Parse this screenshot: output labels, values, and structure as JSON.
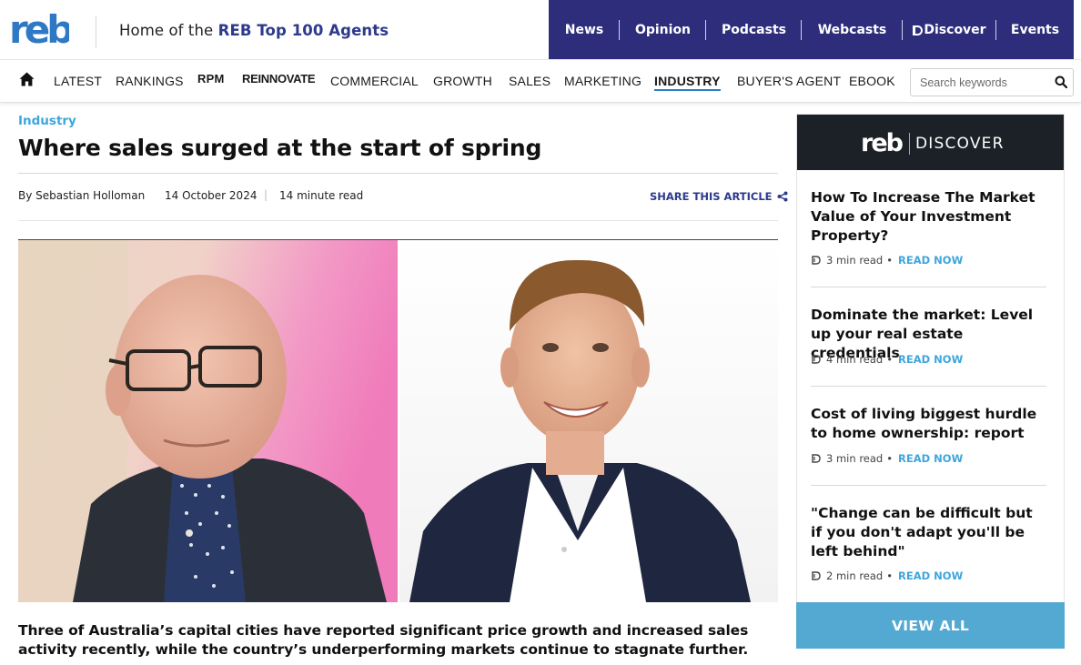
{
  "header": {
    "logo_text": "reb",
    "tagline_prefix": "Home of the ",
    "tagline_highlight": "REB Top 100 Agents",
    "top_nav": [
      "News",
      "Opinion",
      "Podcasts",
      "Webcasts",
      "Discover",
      "Events"
    ]
  },
  "subnav": {
    "items": [
      "LATEST",
      "RANKINGS",
      "RPM",
      "REINNOVATE",
      "COMMERCIAL",
      "GROWTH",
      "SALES",
      "MARKETING",
      "INDUSTRY",
      "BUYER'S AGENT",
      "EBOOK"
    ],
    "active": "INDUSTRY",
    "search_placeholder": "Search keywords"
  },
  "article": {
    "category": "Industry",
    "title": "Where sales surged at the start of spring",
    "byline": "By Sebastian Holloman",
    "date": "14 October 2024",
    "separator": "|",
    "read_time": "14 minute read",
    "share_label": "SHARE THIS ARTICLE",
    "lede": "Three of Australia’s capital cities have reported significant price growth and increased sales activity recently, while the country’s underperforming markets continue to stagnate further."
  },
  "sidebar": {
    "brand_reb": "reb",
    "brand_discover": "DISCOVER",
    "items": [
      {
        "title": "How To Increase The Market Value of Your Investment Property?",
        "read_time": "3 min read",
        "cta": "READ NOW"
      },
      {
        "title": "Dominate the market: Level up your real estate credentials",
        "read_time": "4 min read",
        "cta": "READ NOW"
      },
      {
        "title": "Cost of living biggest hurdle to home ownership: report",
        "read_time": "3 min read",
        "cta": "READ NOW"
      },
      {
        "title": "\"Change can be difficult but if you don't adapt you'll be left behind\"",
        "read_time": "2 min read",
        "cta": "READ NOW"
      }
    ],
    "view_all": "VIEW ALL"
  },
  "colors": {
    "brand_navy": "#2d2d7c",
    "accent_blue": "#3ea6dc",
    "sidebar_head": "#1b2126",
    "view_all_bg": "#53a9d2"
  }
}
